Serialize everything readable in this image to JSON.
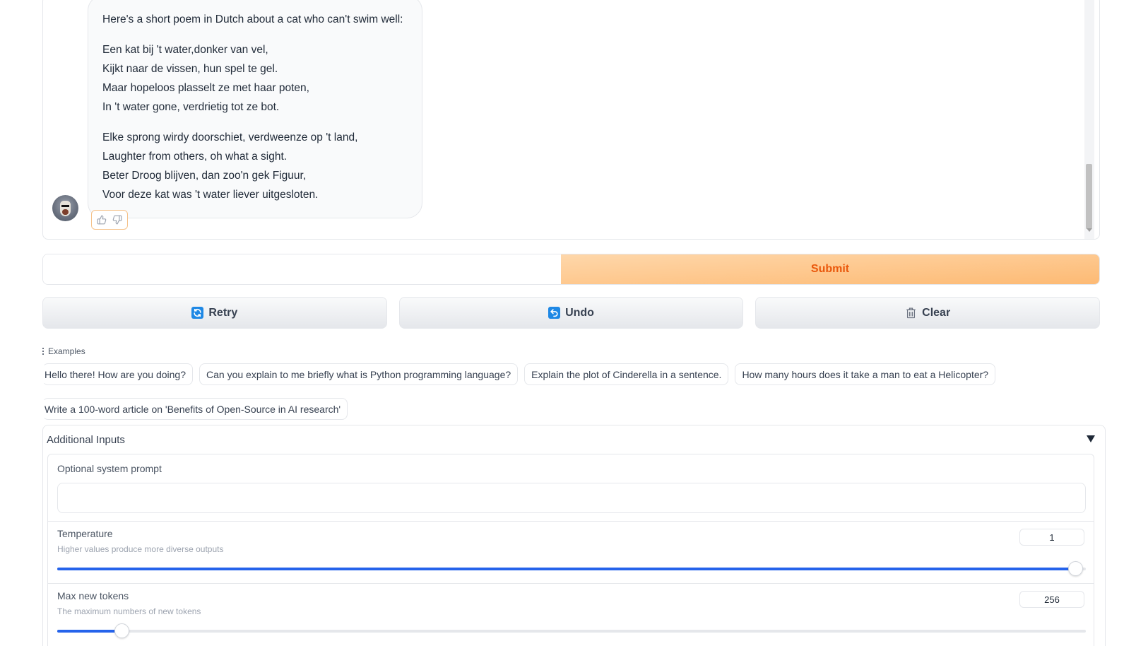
{
  "chat": {
    "intro": "Here's a short poem in Dutch about a cat who can't swim well:",
    "stanza1": [
      "Een kat bij 't water,donker van vel,",
      "Kijkt naar de vissen, hun spel te gel.",
      "Maar hopeloos plasselt ze met haar poten,",
      "In 't water gone, verdrietig tot ze bot."
    ],
    "stanza2": [
      "Elke sprong wirdy doorschiet, verdweenze op 't land,",
      "Laughter from others, oh what a sight.",
      "Beter Droog blijven, dan zoo'n gek Figuur,",
      "Voor deze kat was 't water liever uitgesloten."
    ],
    "icons": {
      "avatar": "llama-avatar",
      "like": "thumbs-up-icon",
      "dislike": "thumbs-down-icon"
    }
  },
  "input": {
    "value": "",
    "placeholder": ""
  },
  "submit_label": "Submit",
  "buttons": {
    "retry": {
      "label": "Retry",
      "icon": "retry-icon"
    },
    "undo": {
      "label": "Undo",
      "icon": "undo-icon"
    },
    "clear": {
      "label": "Clear",
      "icon": "trash-icon"
    }
  },
  "examples": {
    "label": "Examples",
    "items": [
      "Hello there! How are you doing?",
      "Can you explain to me briefly what is Python programming language?",
      "Explain the plot of Cinderella in a sentence.",
      "How many hours does it take a man to eat a Helicopter?",
      "Write a 100-word article on 'Benefits of Open-Source in AI research'"
    ]
  },
  "additional_inputs": {
    "title": "Additional Inputs",
    "system_prompt": {
      "label": "Optional system prompt",
      "value": ""
    },
    "temperature": {
      "label": "Temperature",
      "info": "Higher values produce more diverse outputs",
      "value": "1",
      "fraction": 0.99
    },
    "max_new_tokens": {
      "label": "Max new tokens",
      "info": "The maximum numbers of new tokens",
      "value": "256",
      "fraction": 0.0625
    }
  },
  "colors": {
    "accent": "#2563eb",
    "submit_text": "#ea580c",
    "submit_bg": "#fdba74",
    "icon_blue": "#1e88e5"
  }
}
